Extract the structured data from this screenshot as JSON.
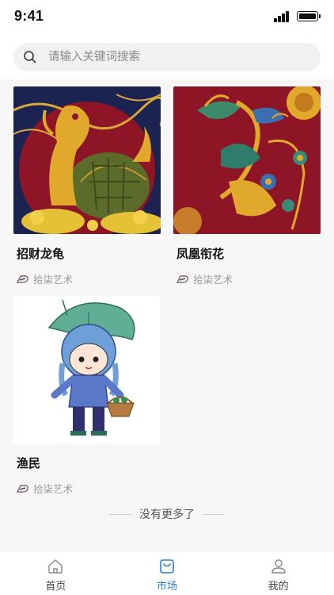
{
  "status_bar": {
    "time": "9:41"
  },
  "search": {
    "placeholder": "请输入关键词搜索"
  },
  "products": [
    {
      "title": "招财龙龟",
      "author": "拾柒艺术",
      "image": "dragon-turtle-artwork"
    },
    {
      "title": "凤凰衔花",
      "author": "拾柒艺术",
      "image": "phoenix-artwork"
    },
    {
      "title": "渔民",
      "author": "拾柒艺术",
      "image": "fisher-girl-cartoon"
    }
  ],
  "end_text": "没有更多了",
  "tabbar": {
    "items": [
      {
        "label": "首页",
        "icon": "home-icon"
      },
      {
        "label": "市场",
        "icon": "market-bag-icon"
      },
      {
        "label": "我的",
        "icon": "user-icon"
      }
    ],
    "active_index": 1
  },
  "colors": {
    "accent": "#2a7fd6",
    "artwork_red": "#8e1525",
    "artwork_navy": "#1b2350",
    "artwork_gold": "#e0a92c"
  }
}
